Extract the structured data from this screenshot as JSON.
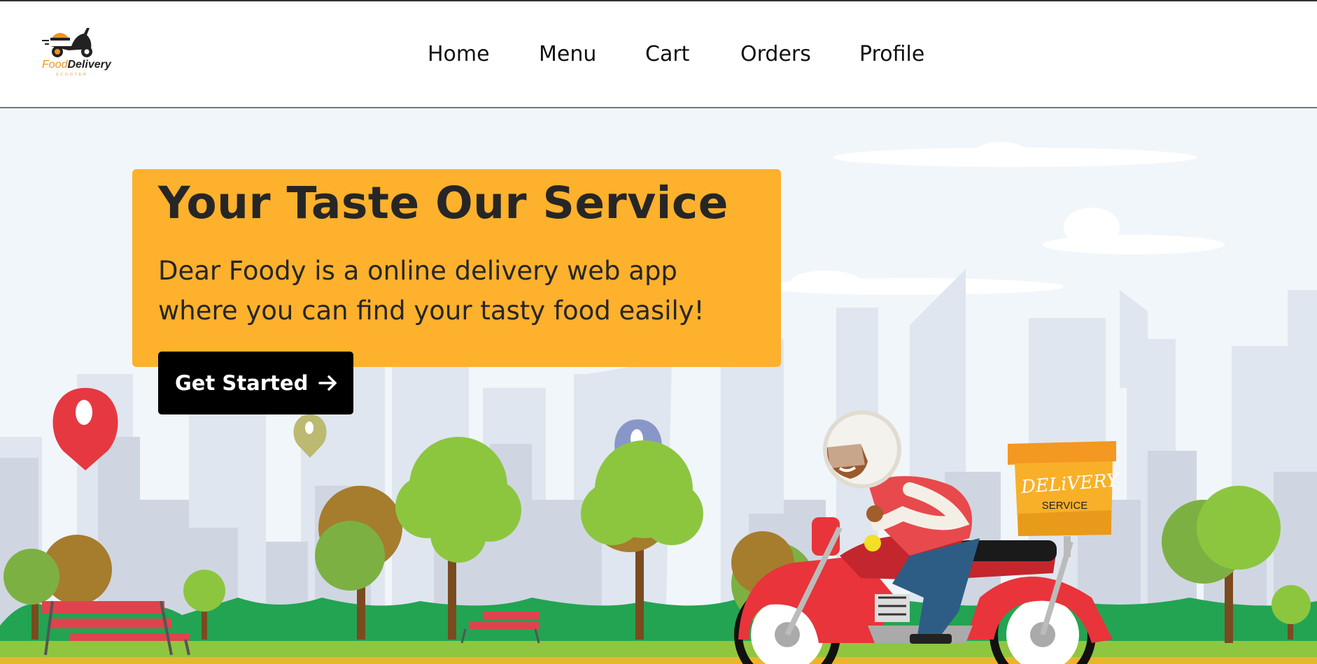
{
  "brand": {
    "logo_word_1": "Food",
    "logo_word_2": "Delivery",
    "logo_tagline": "SCOOTER",
    "accent_color": "#fdb12c",
    "logo_orange": "#f0921f"
  },
  "nav": {
    "items": [
      {
        "label": "Home"
      },
      {
        "label": "Menu"
      },
      {
        "label": "Cart"
      },
      {
        "label": "Orders"
      },
      {
        "label": "Profile"
      }
    ]
  },
  "hero": {
    "title": "Your Taste Our Service",
    "description": "Dear Foody is a online delivery web app where you can find your tasty food easily!",
    "cta_label": "Get Started",
    "cta_icon": "arrow-right-icon",
    "box_text_1": "DELiVERY",
    "box_text_2": "SERVICE"
  }
}
